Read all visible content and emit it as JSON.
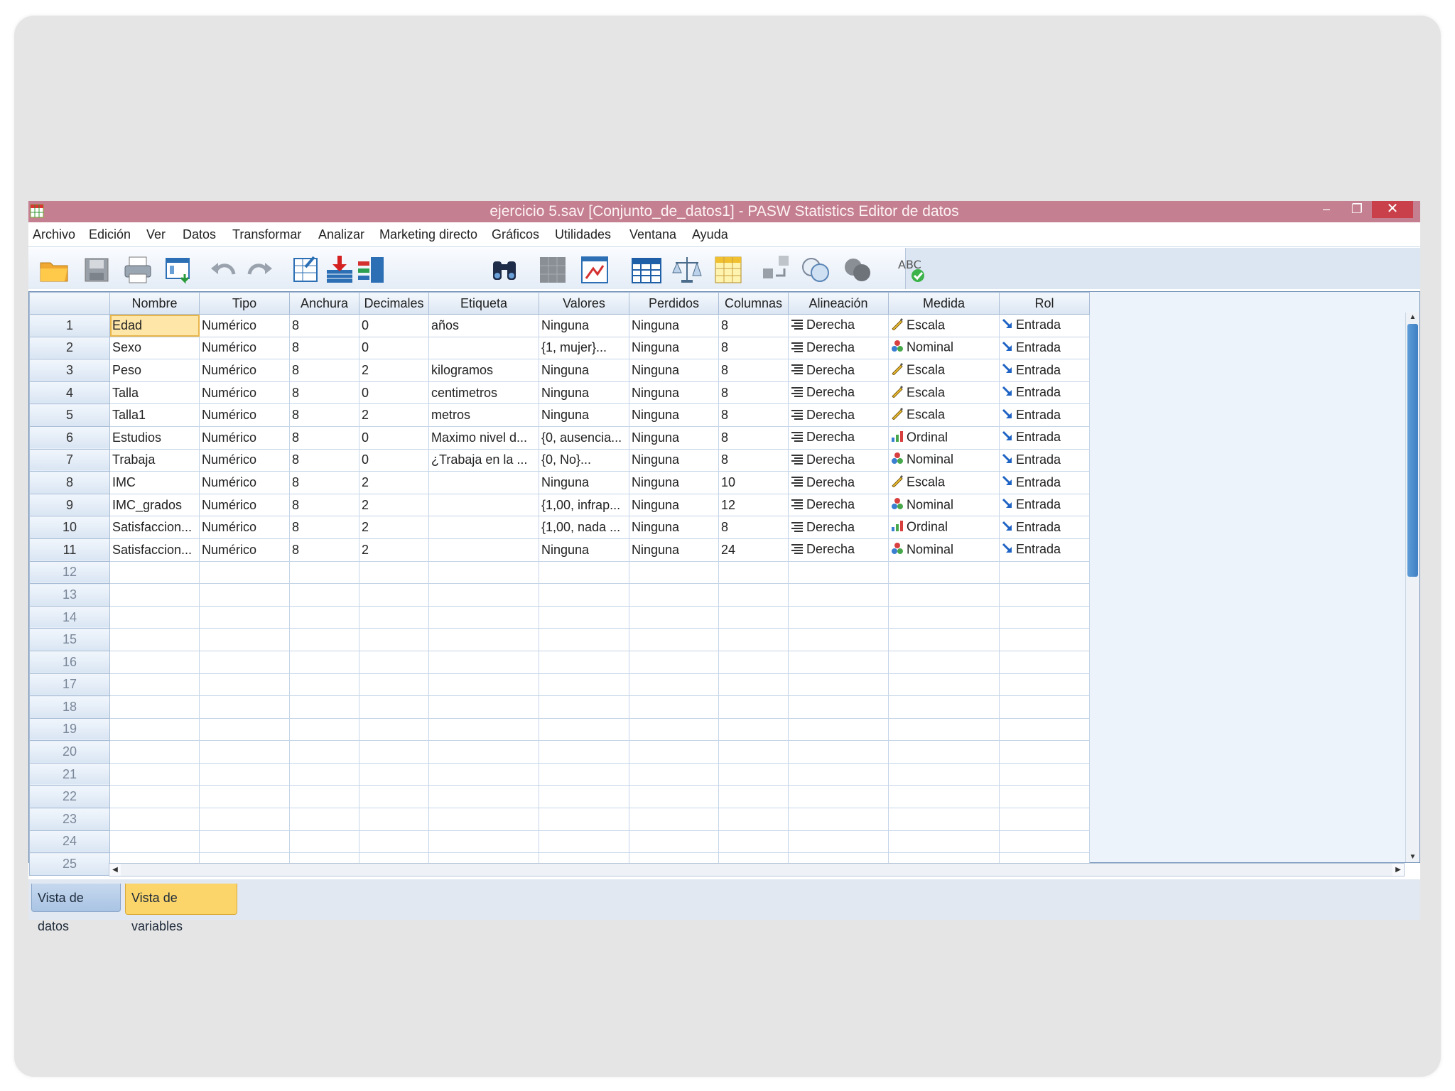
{
  "window": {
    "title": "ejercicio 5.sav [Conjunto_de_datos1] - PASW Statistics Editor de datos",
    "controls": {
      "minimize": "–",
      "restore": "❐",
      "close": "✕"
    }
  },
  "menu": [
    "Archivo",
    "Edición",
    "Ver",
    "Datos",
    "Transformar",
    "Analizar",
    "Marketing directo",
    "Gráficos",
    "Utilidades",
    "Ventana",
    "Ayuda"
  ],
  "toolbar_icons": [
    "open-folder-icon",
    "save-icon",
    "print-icon",
    "recall-dialog-icon",
    "undo-icon",
    "redo-icon",
    "goto-case-icon",
    "goto-variable-icon",
    "variables-icon",
    "find-icon",
    "insert-cases-icon",
    "insert-variable-icon",
    "split-file-icon",
    "weight-cases-icon",
    "select-cases-icon",
    "value-labels-icon",
    "use-sets-icon",
    "show-all-variables-icon",
    "spell-check-icon"
  ],
  "columns": [
    "Nombre",
    "Tipo",
    "Anchura",
    "Decimales",
    "Etiqueta",
    "Valores",
    "Perdidos",
    "Columnas",
    "Alineación",
    "Medida",
    "Rol"
  ],
  "rows": [
    {
      "n": "1",
      "nombre": "Edad",
      "tipo": "Numérico",
      "anchura": "8",
      "decimales": "0",
      "etiqueta": "años",
      "valores": "Ninguna",
      "perdidos": "Ninguna",
      "columnas": "8",
      "alineacion": "Derecha",
      "medida": "Escala",
      "medida_icon": "scale-ruler-icon",
      "rol": "Entrada"
    },
    {
      "n": "2",
      "nombre": "Sexo",
      "tipo": "Numérico",
      "anchura": "8",
      "decimales": "0",
      "etiqueta": "",
      "valores": "{1, mujer}...",
      "perdidos": "Ninguna",
      "columnas": "8",
      "alineacion": "Derecha",
      "medida": "Nominal",
      "medida_icon": "nominal-circles-icon",
      "rol": "Entrada"
    },
    {
      "n": "3",
      "nombre": "Peso",
      "tipo": "Numérico",
      "anchura": "8",
      "decimales": "2",
      "etiqueta": "kilogramos",
      "valores": "Ninguna",
      "perdidos": "Ninguna",
      "columnas": "8",
      "alineacion": "Derecha",
      "medida": "Escala",
      "medida_icon": "scale-ruler-icon",
      "rol": "Entrada"
    },
    {
      "n": "4",
      "nombre": "Talla",
      "tipo": "Numérico",
      "anchura": "8",
      "decimales": "0",
      "etiqueta": "centimetros",
      "valores": "Ninguna",
      "perdidos": "Ninguna",
      "columnas": "8",
      "alineacion": "Derecha",
      "medida": "Escala",
      "medida_icon": "scale-ruler-icon",
      "rol": "Entrada"
    },
    {
      "n": "5",
      "nombre": "Talla1",
      "tipo": "Numérico",
      "anchura": "8",
      "decimales": "2",
      "etiqueta": "metros",
      "valores": "Ninguna",
      "perdidos": "Ninguna",
      "columnas": "8",
      "alineacion": "Derecha",
      "medida": "Escala",
      "medida_icon": "scale-ruler-icon",
      "rol": "Entrada"
    },
    {
      "n": "6",
      "nombre": "Estudios",
      "tipo": "Numérico",
      "anchura": "8",
      "decimales": "0",
      "etiqueta": "Maximo nivel d...",
      "valores": "{0, ausencia...",
      "perdidos": "Ninguna",
      "columnas": "8",
      "alineacion": "Derecha",
      "medida": "Ordinal",
      "medida_icon": "ordinal-bars-icon",
      "rol": "Entrada"
    },
    {
      "n": "7",
      "nombre": "Trabaja",
      "tipo": "Numérico",
      "anchura": "8",
      "decimales": "0",
      "etiqueta": "¿Trabaja en la ...",
      "valores": "{0, No}...",
      "perdidos": "Ninguna",
      "columnas": "8",
      "alineacion": "Derecha",
      "medida": "Nominal",
      "medida_icon": "nominal-circles-icon",
      "rol": "Entrada"
    },
    {
      "n": "8",
      "nombre": "IMC",
      "tipo": "Numérico",
      "anchura": "8",
      "decimales": "2",
      "etiqueta": "",
      "valores": "Ninguna",
      "perdidos": "Ninguna",
      "columnas": "10",
      "alineacion": "Derecha",
      "medida": "Escala",
      "medida_icon": "scale-ruler-icon",
      "rol": "Entrada"
    },
    {
      "n": "9",
      "nombre": "IMC_grados",
      "tipo": "Numérico",
      "anchura": "8",
      "decimales": "2",
      "etiqueta": "",
      "valores": "{1,00, infrap...",
      "perdidos": "Ninguna",
      "columnas": "12",
      "alineacion": "Derecha",
      "medida": "Nominal",
      "medida_icon": "nominal-circles-icon",
      "rol": "Entrada"
    },
    {
      "n": "10",
      "nombre": "Satisfaccion...",
      "tipo": "Numérico",
      "anchura": "8",
      "decimales": "2",
      "etiqueta": "",
      "valores": "{1,00, nada ...",
      "perdidos": "Ninguna",
      "columnas": "8",
      "alineacion": "Derecha",
      "medida": "Ordinal",
      "medida_icon": "ordinal-bars-icon",
      "rol": "Entrada"
    },
    {
      "n": "11",
      "nombre": "Satisfaccion...",
      "tipo": "Numérico",
      "anchura": "8",
      "decimales": "2",
      "etiqueta": "",
      "valores": "Ninguna",
      "perdidos": "Ninguna",
      "columnas": "24",
      "alineacion": "Derecha",
      "medida": "Nominal",
      "medida_icon": "nominal-circles-icon",
      "rol": "Entrada"
    }
  ],
  "empty_rows": [
    "12",
    "13",
    "14",
    "15",
    "16",
    "17",
    "18",
    "19",
    "20",
    "21",
    "22",
    "23",
    "24",
    "25"
  ],
  "tabs": {
    "data_view": "Vista de datos",
    "variable_view": "Vista de variables",
    "active": "Vista de variables"
  },
  "colors": {
    "titlebar": "#c47f91",
    "close": "#c9404a",
    "active_tab": "#fbd56a",
    "selected_cell": "#fde6a8"
  }
}
